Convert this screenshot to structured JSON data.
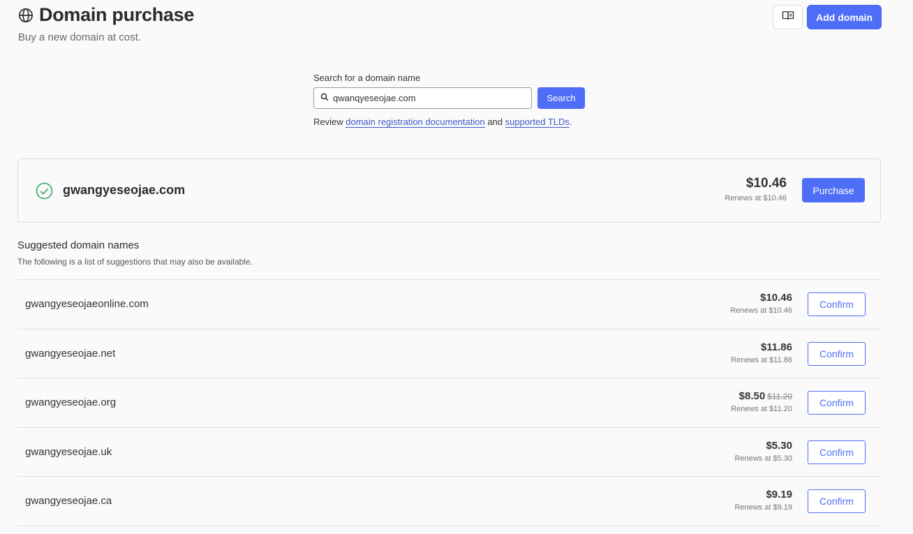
{
  "header": {
    "icon": "globe-icon",
    "title": "Domain purchase",
    "subtitle": "Buy a new domain at cost."
  },
  "top_actions": {
    "docs_icon": "book-icon",
    "add_domain_label": "Add domain"
  },
  "search": {
    "label": "Search for a domain name",
    "value": "qwanqyeseojae.com",
    "button_label": "Search",
    "review_prefix": "Review ",
    "doc_link": "domain registration documentation",
    "and_text": " and ",
    "tld_link": "supported TLDs",
    "review_suffix": "."
  },
  "result": {
    "status_icon": "check-circle-icon",
    "domain": "gwangyeseojae.com",
    "price": "$10.46",
    "renew": "Renews at $10.46",
    "button_label": "Purchase"
  },
  "suggestions": {
    "title": "Suggested domain names",
    "description": "The following is a list of suggestions that may also be available.",
    "confirm_label": "Confirm",
    "items": [
      {
        "domain": "gwangyeseojaeonline.com",
        "price": "$10.46",
        "old_price": "",
        "renew": "Renews at $10.46"
      },
      {
        "domain": "gwangyeseojae.net",
        "price": "$11.86",
        "old_price": "",
        "renew": "Renews at $11.86"
      },
      {
        "domain": "gwangyeseojae.org",
        "price": "$8.50",
        "old_price": "$11.20",
        "renew": "Renews at $11.20"
      },
      {
        "domain": "gwangyeseojae.uk",
        "price": "$5.30",
        "old_price": "",
        "renew": "Renews at $5.30"
      },
      {
        "domain": "gwangyeseojae.ca",
        "price": "$9.19",
        "old_price": "",
        "renew": "Renews at $9.19"
      }
    ]
  },
  "colors": {
    "accent": "#4f6ef7",
    "link": "#3b56c9",
    "success": "#4caf72"
  }
}
